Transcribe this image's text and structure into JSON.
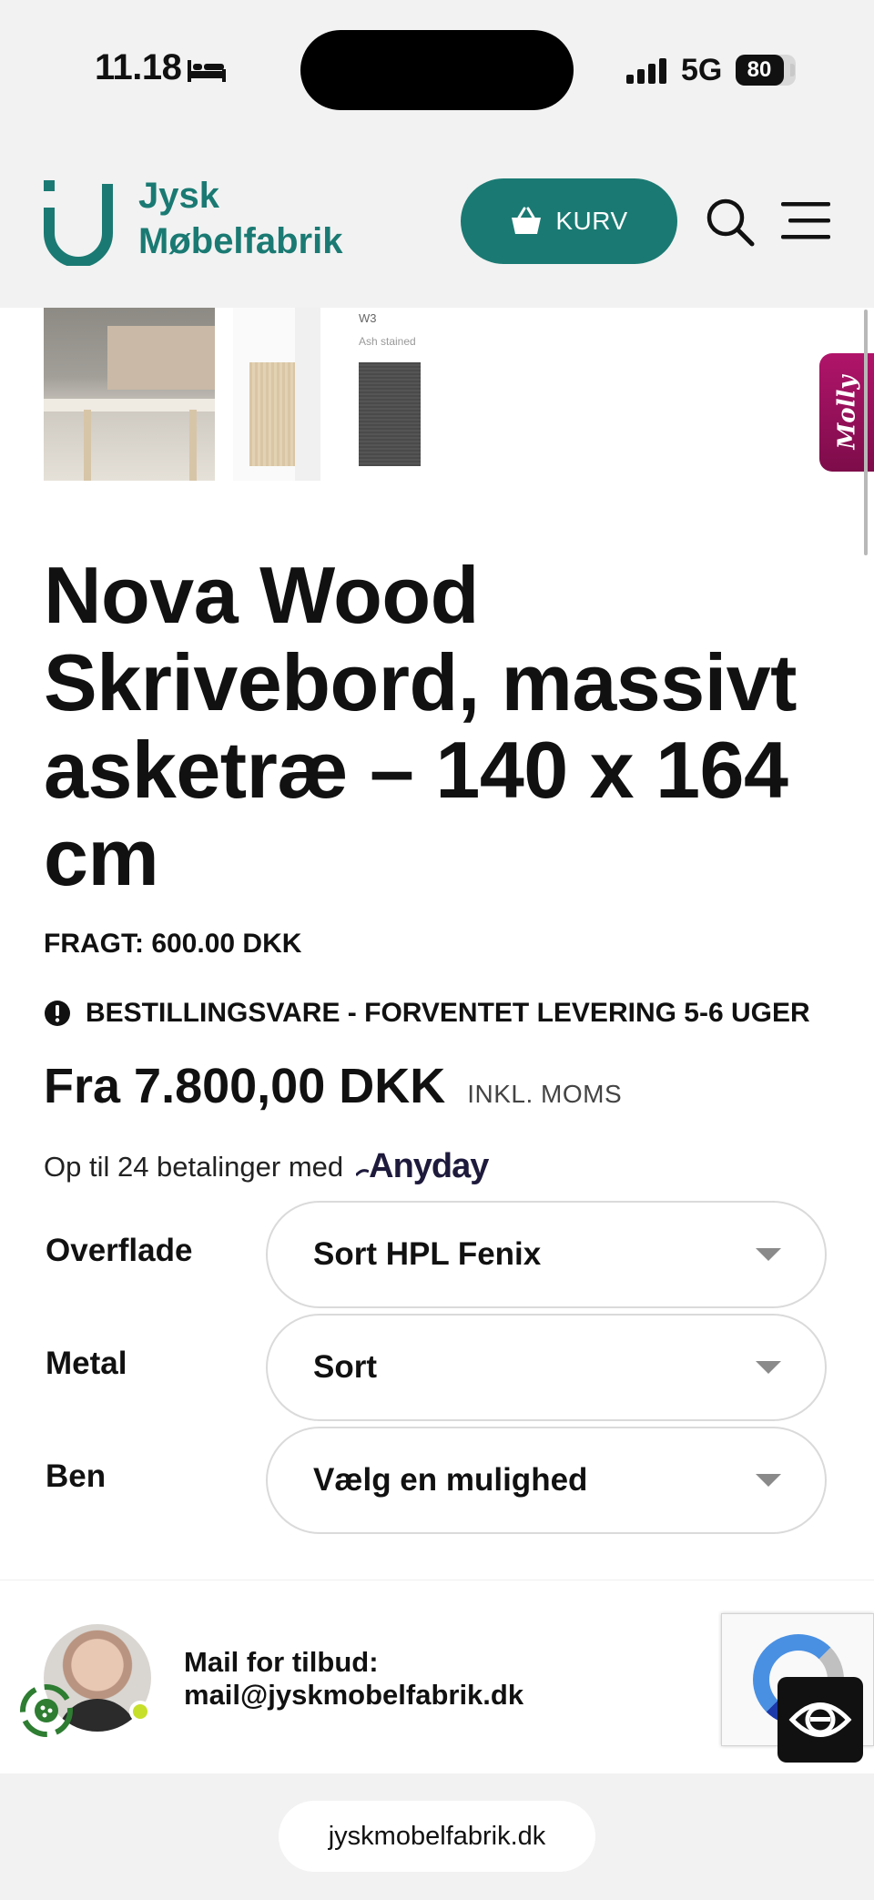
{
  "status_bar": {
    "time": "11.18",
    "network": "5G",
    "battery": "80",
    "battery_level": 0.8
  },
  "header": {
    "logo_line1": "Jysk",
    "logo_line2": "Møbelfabrik",
    "cart_label": "KURV",
    "brand_color": "#1a7a73"
  },
  "gallery": {
    "thumb3_caption": "W3",
    "thumb3_subcaption": "Ash stained"
  },
  "chat_widget": {
    "label": "Molly"
  },
  "product": {
    "title": "Nova Wood Skrivebord, massivt asketræ – 140 x 164 cm",
    "freight": "FRAGT: 600.00 DKK",
    "order_notice": "BESTILLINGSVARE - FORVENTET LEVERING 5-6 UGER",
    "price": "Fra 7.800,00 DKK",
    "vat_note": "INKL. MOMS",
    "installments_text": "Op til 24 betalinger med",
    "installments_brand": "Anyday"
  },
  "options": [
    {
      "label": "Overflade",
      "value": "Sort HPL Fenix"
    },
    {
      "label": "Metal",
      "value": "Sort"
    },
    {
      "label": "Ben",
      "value": "Vælg en mulighed"
    }
  ],
  "contact": {
    "label": "Mail for tilbud:",
    "email": "mail@jyskmobelfabrik.dk"
  },
  "browser": {
    "url": "jyskmobelfabrik.dk"
  }
}
